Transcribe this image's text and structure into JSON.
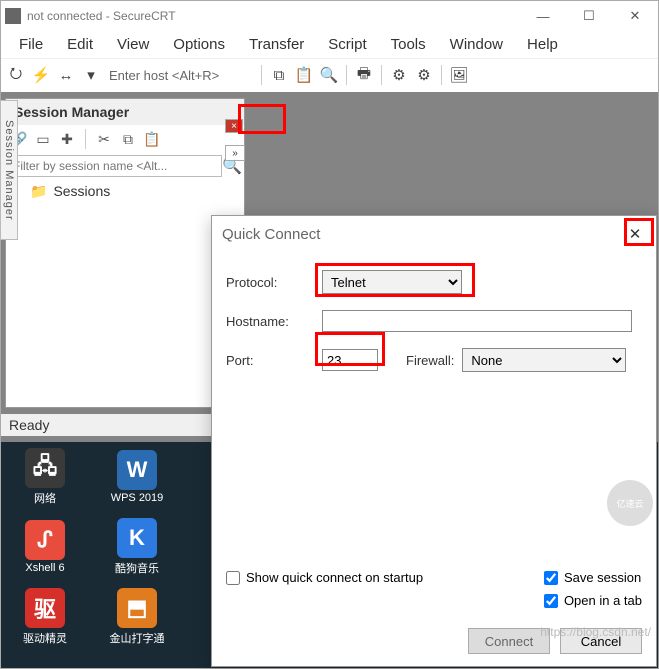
{
  "window": {
    "title": "not connected - SecureCRT",
    "min_icon": "—",
    "max_icon": "☐",
    "close_icon": "✕"
  },
  "menu": [
    "File",
    "Edit",
    "View",
    "Options",
    "Transfer",
    "Script",
    "Tools",
    "Window",
    "Help"
  ],
  "toolbar": {
    "host_placeholder": "Enter host <Alt+R>"
  },
  "sessionManager": {
    "title": "Session Manager",
    "filterPlaceholder": "Filter by session name <Alt...",
    "rootNode": "Sessions"
  },
  "sidetab": "Session Manager",
  "status": "Ready",
  "desktop": {
    "row1": [
      {
        "label": "网络",
        "color": "#3a3a3a"
      },
      {
        "label": "WPS 2019",
        "color": "#2a6bb2"
      }
    ],
    "row2": [
      {
        "label": "Xshell 6",
        "glyph": "ᔑ",
        "color": "#e74c3c"
      },
      {
        "label": "酷狗音乐",
        "glyph": "K",
        "color": "#2d7be0"
      }
    ],
    "row3": [
      {
        "label": "驱动精灵",
        "glyph": "驱",
        "color": "#d6302b"
      },
      {
        "label": "金山打字通",
        "glyph": "⬒",
        "color": "#e07b1f"
      }
    ]
  },
  "quickConnect": {
    "title": "Quick Connect",
    "protocolLabel": "Protocol:",
    "protocolValue": "Telnet",
    "hostnameLabel": "Hostname:",
    "hostnameValue": "",
    "portLabel": "Port:",
    "portValue": "23",
    "firewallLabel": "Firewall:",
    "firewallValue": "None",
    "showOnStartup": "Show quick connect on startup",
    "saveSession": "Save session",
    "openInTab": "Open in a tab",
    "connect": "Connect",
    "cancel": "Cancel"
  },
  "watermark": "https://blog.csdn.net/",
  "wm2": "亿速云"
}
